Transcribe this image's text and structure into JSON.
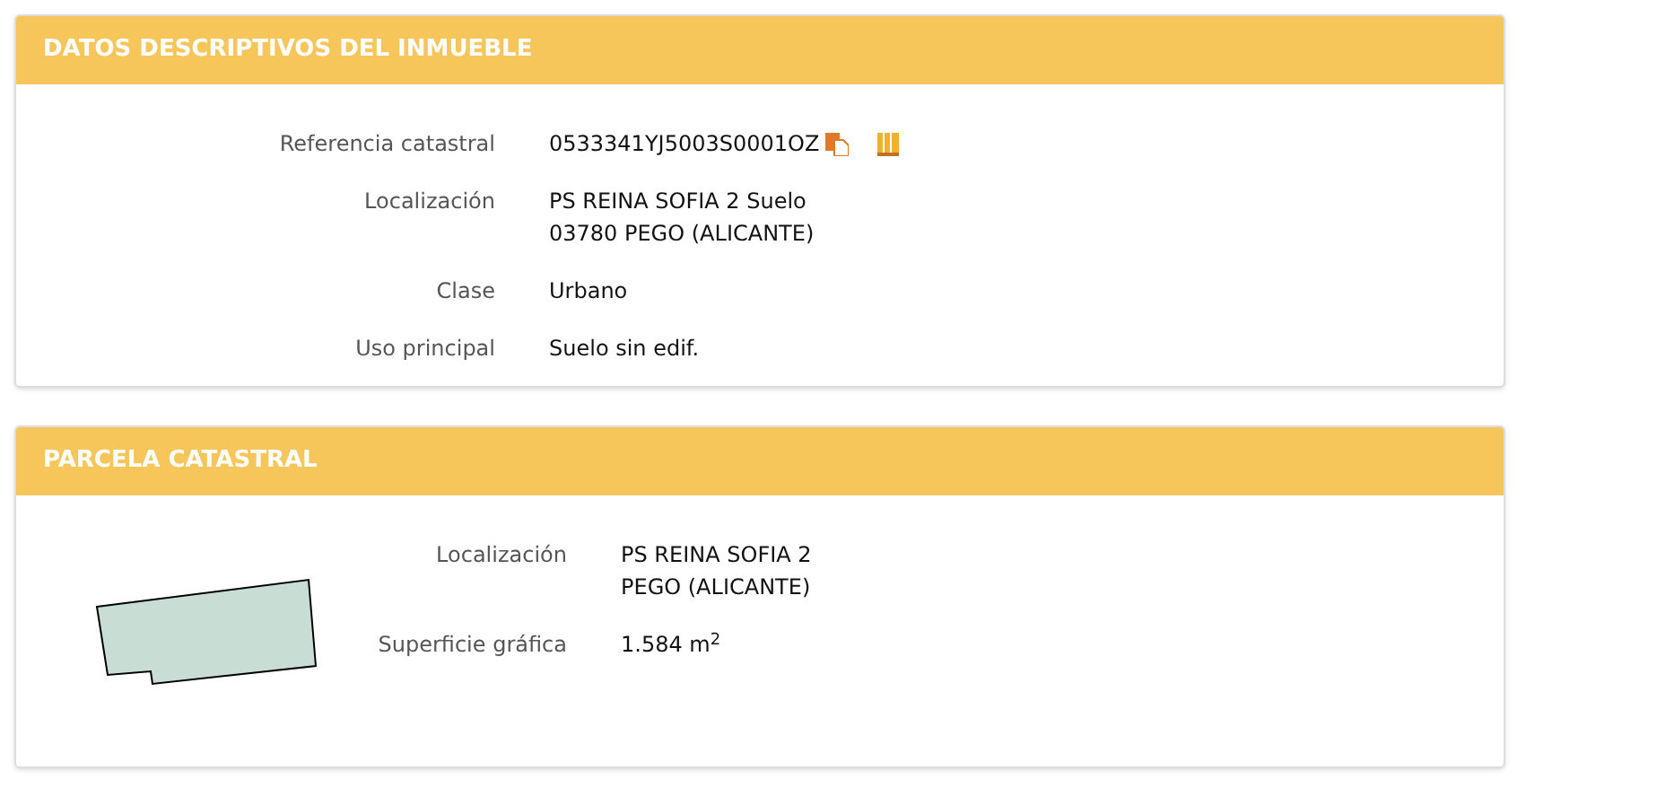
{
  "inmueble": {
    "title": "DATOS DESCRIPTIVOS DEL INMUEBLE",
    "rows": [
      {
        "label": "Referencia catastral",
        "lines": [
          "0533341YJ5003S0001OZ"
        ],
        "kind": "reference"
      },
      {
        "label": "Localización",
        "lines": [
          "PS REINA SOFIA 2 Suelo",
          "03780 PEGO (ALICANTE)"
        ]
      },
      {
        "label": "Clase",
        "lines": [
          "Urbano"
        ]
      },
      {
        "label": "Uso principal",
        "lines": [
          "Suelo sin edif."
        ]
      }
    ]
  },
  "parcela": {
    "title": "PARCELA CATASTRAL",
    "rows": [
      {
        "label": "Localización",
        "lines": [
          "PS REINA SOFIA 2",
          "PEGO (ALICANTE)"
        ]
      },
      {
        "label": "Superficie gráfica",
        "lines": [
          "1.584 m$^{2}$"
        ]
      }
    ]
  }
}
